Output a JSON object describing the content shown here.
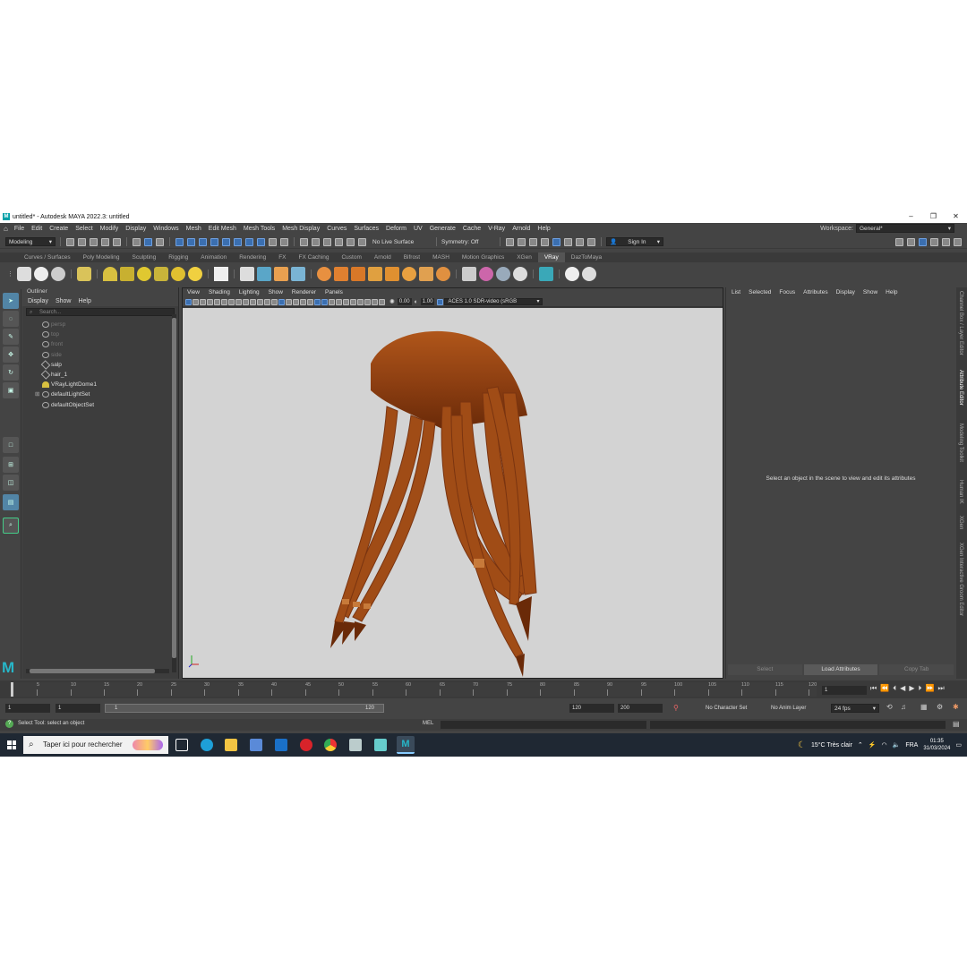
{
  "window": {
    "title": "untitled* - Autodesk MAYA 2022.3: untitled",
    "logo": "M"
  },
  "menu": [
    "File",
    "Edit",
    "Create",
    "Select",
    "Modify",
    "Display",
    "Windows",
    "Mesh",
    "Edit Mesh",
    "Mesh Tools",
    "Mesh Display",
    "Curves",
    "Surfaces",
    "Deform",
    "UV",
    "Generate",
    "Cache",
    "V-Ray",
    "Arnold",
    "Help"
  ],
  "workspace": {
    "label": "Workspace:",
    "value": "General*"
  },
  "status": {
    "mode": "Modeling",
    "live_surface": "No Live Surface",
    "symmetry": "Symmetry: Off",
    "sign_in": "Sign In"
  },
  "shelf_tabs": [
    "Curves / Surfaces",
    "Poly Modeling",
    "Sculpting",
    "Rigging",
    "Animation",
    "Rendering",
    "FX",
    "FX Caching",
    "Custom",
    "Arnold",
    "Bifrost",
    "MASH",
    "Motion Graphics",
    "XGen",
    "VRay",
    "DazToMaya"
  ],
  "shelf_active": "VRay",
  "outliner": {
    "title": "Outliner",
    "menu": [
      "Display",
      "Show",
      "Help"
    ],
    "search_placeholder": "Search...",
    "items": [
      {
        "label": "persp",
        "dim": true
      },
      {
        "label": "top",
        "dim": true
      },
      {
        "label": "front",
        "dim": true
      },
      {
        "label": "side",
        "dim": true
      },
      {
        "label": "salp",
        "dim": false
      },
      {
        "label": "hair_1",
        "dim": false
      },
      {
        "label": "VRayLightDome1",
        "dim": false
      },
      {
        "label": "defaultLightSet",
        "dim": false
      },
      {
        "label": "defaultObjectSet",
        "dim": false
      }
    ]
  },
  "viewport": {
    "menu": [
      "View",
      "Shading",
      "Lighting",
      "Show",
      "Renderer",
      "Panels"
    ],
    "exposure": "0.00",
    "gamma": "1.00",
    "color_space": "ACES 1.0 SDR-video (sRGB"
  },
  "attribute_editor": {
    "menu": [
      "List",
      "Selected",
      "Focus",
      "Attributes",
      "Display",
      "Show",
      "Help"
    ],
    "hint": "Select an object in the scene to view and edit its attributes",
    "buttons": [
      "Select",
      "Load Attributes",
      "Copy Tab"
    ]
  },
  "side_tabs": [
    "Channel Box / Layer Editor",
    "Attribute Editor",
    "Modeling Toolkit",
    "Human IK",
    "XGen",
    "XGen Interactive Groom Editor"
  ],
  "timeline": {
    "ticks": [
      "5",
      "10",
      "15",
      "20",
      "25",
      "30",
      "35",
      "40",
      "45",
      "50",
      "55",
      "60",
      "65",
      "70",
      "75",
      "80",
      "85",
      "90",
      "95",
      "100",
      "105",
      "110",
      "115",
      "120"
    ],
    "current_frame": "1",
    "start": "1",
    "playback_start": "1",
    "range_start": "1",
    "range_end": "120",
    "playback_end": "120",
    "end": "200",
    "character_set": "No Character Set",
    "anim_layer": "No Anim Layer",
    "fps": "24 fps"
  },
  "command": {
    "help": "Select Tool: select an object",
    "lang": "MEL"
  },
  "taskbar": {
    "search_placeholder": "Taper ici pour rechercher",
    "weather": "15°C  Très clair",
    "lang": "FRA",
    "time": "01:35",
    "date": "31/03/2024"
  },
  "colors": {
    "accent": "#5285a6",
    "maya_teal": "#27b6c8",
    "hair": "#9a4a15"
  }
}
